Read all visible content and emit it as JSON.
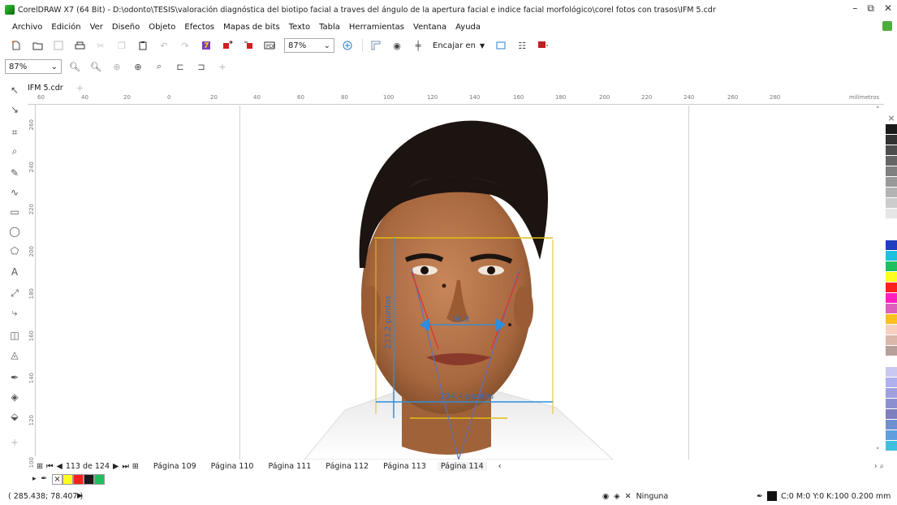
{
  "window": {
    "title": "CorelDRAW X7 (64 Bit) - D:\\odonto\\TESIS\\valoración diagnóstica del biotipo facial a traves del ángulo de la apertura facial e indice facial morfológico\\corel fotos con trasos\\IFM 5.cdr",
    "minimize": "–",
    "restore": "⧉",
    "close": "✕"
  },
  "menu": [
    "Archivo",
    "Edición",
    "Ver",
    "Diseño",
    "Objeto",
    "Efectos",
    "Mapas de bits",
    "Texto",
    "Tabla",
    "Herramientas",
    "Ventana",
    "Ayuda"
  ],
  "toolbar": {
    "zoom_value": "87%",
    "snap_label": "Encajar en",
    "icons": [
      "new-icon",
      "open-icon",
      "save-icon",
      "print-icon",
      "cut-icon",
      "copy-icon",
      "paste-icon",
      "undo-icon",
      "redo-icon",
      "search-content-icon",
      "import-icon",
      "export-icon",
      "publish-pdf-icon"
    ]
  },
  "property_bar": {
    "zoom_value": "87%"
  },
  "document": {
    "tab_label": "IFM 5.cdr",
    "add_tab": "+"
  },
  "ruler": {
    "unit_label": "milímetros",
    "h_ticks": [
      "60",
      "40",
      "20",
      "0",
      "20",
      "40",
      "60",
      "80",
      "100",
      "120",
      "140",
      "160",
      "180",
      "200",
      "220",
      "240",
      "260",
      "280"
    ],
    "v_ticks": [
      "260",
      "240",
      "220",
      "200",
      "180",
      "160",
      "140",
      "120",
      "100"
    ]
  },
  "measurements": {
    "height_label": "233.2 puntos",
    "width_label": "234.4 puntos",
    "inner_label": "56.8"
  },
  "page_nav": {
    "counter": "113 de 124",
    "pages": [
      "Página 109",
      "Página 110",
      "Página 111",
      "Página 112",
      "Página 113",
      "Página 114"
    ],
    "active_page": "Página 114"
  },
  "palette_colors": [
    "#1a1a1a",
    "#333333",
    "#4d4d4d",
    "#666666",
    "#808080",
    "#999999",
    "#b3b3b3",
    "#cccccc",
    "#e6e6e6",
    "#ffffff",
    "#ffffff",
    "#1f3fbf",
    "#1fbfdf",
    "#1fbf5f",
    "#ffff1f",
    "#ff1f1f",
    "#ff1fbf",
    "#df5fbf",
    "#ffbf1f",
    "#f5d0c0",
    "#d9b8a8",
    "#b8a09a",
    "#ffffff",
    "#c8c8f0",
    "#b0b0f0",
    "#9f9fdf",
    "#8f8fcf",
    "#7f7fbf",
    "#6f8fcf",
    "#5f9fdf",
    "#3fbfdf"
  ],
  "document_palette": [
    "#ffff1f",
    "#ff1f1f",
    "#1a1a1a",
    "#1fbf5f"
  ],
  "status": {
    "coordinates": "( 285.438; 78.407 )",
    "fill_label": "Ninguna",
    "outline_label": "C:0 M:0 Y:0 K:100  0.200 mm",
    "outline_color": "#111111"
  }
}
